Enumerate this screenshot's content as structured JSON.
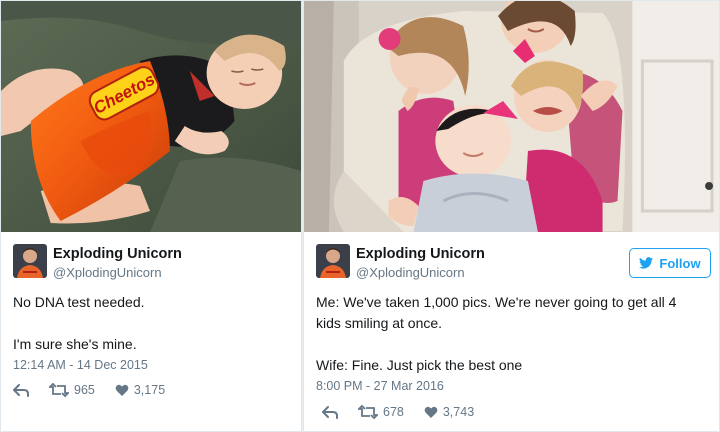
{
  "colors": {
    "twitter_blue": "#1da1f2",
    "secondary_text": "#657786",
    "primary_text": "#14171a",
    "border": "#e1e8ed",
    "background": "#e6ecf0"
  },
  "tweets": [
    {
      "photo_caption": "Cheetos",
      "user": {
        "display_name": "Exploding Unicorn",
        "handle": "@XplodingUnicorn",
        "avatar_icon": "user-avatar"
      },
      "text_lines": [
        "No DNA test needed.",
        "I'm sure she's mine."
      ],
      "timestamp": "12:14 AM - 14 Dec 2015",
      "retweets": "965",
      "likes": "3,175",
      "icons": {
        "reply": "reply-icon",
        "retweet": "retweet-icon",
        "like": "heart-icon"
      }
    },
    {
      "user": {
        "display_name": "Exploding Unicorn",
        "handle": "@XplodingUnicorn",
        "avatar_icon": "user-avatar"
      },
      "follow_label": "Follow",
      "text_lines": [
        "Me: We've taken 1,000 pics. We're never going to get all 4",
        "kids smiling at once.",
        "Wife: Fine. Just pick the best one"
      ],
      "timestamp": "8:00 PM - 27 Mar 2016",
      "retweets": "678",
      "likes": "3,743",
      "icons": {
        "reply": "reply-icon",
        "retweet": "retweet-icon",
        "like": "heart-icon"
      }
    }
  ]
}
